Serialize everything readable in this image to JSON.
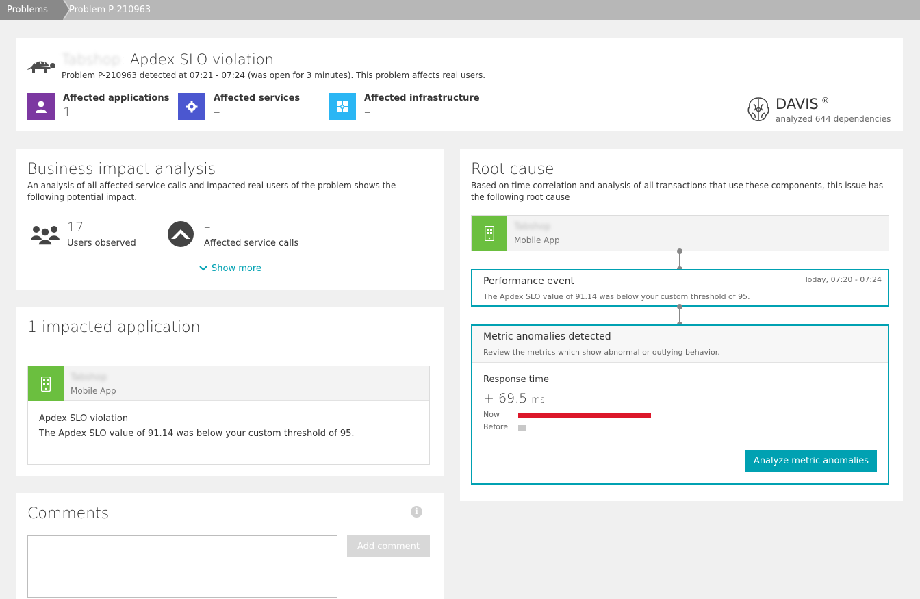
{
  "breadcrumb": {
    "items": [
      "Problems",
      "Problem P-210963"
    ]
  },
  "header": {
    "app_name": "Tabshop",
    "title_suffix": ": Apdex SLO violation",
    "subtitle": "Problem P-210963 detected at 07:21 - 07:24 (was open for 3 minutes). This problem affects real users.",
    "affected": [
      {
        "label": "Affected applications",
        "value": "1",
        "color": "#7c38a1"
      },
      {
        "label": "Affected services",
        "value": "–",
        "color": "#4b57d0"
      },
      {
        "label": "Affected infrastructure",
        "value": "–",
        "color": "#2ab6f4"
      }
    ],
    "davis": {
      "name": "DAVIS",
      "mark": "®",
      "subtitle": "analyzed 644 dependencies"
    }
  },
  "business_impact": {
    "title": "Business impact analysis",
    "description": "An analysis of all affected service calls and impacted real users of the problem shows the following potential impact.",
    "users_value": "17",
    "users_label": "Users observed",
    "calls_value": "–",
    "calls_label": "Affected service calls",
    "show_more": "Show more"
  },
  "impacted": {
    "title": "1 impacted application",
    "app_name": "Tabshop",
    "app_type": "Mobile App",
    "issue_title": "Apdex SLO violation",
    "issue_desc": "The Apdex SLO value of 91.14 was below your custom threshold of 95."
  },
  "comments": {
    "title": "Comments",
    "info_glyph": "i",
    "add_label": "Add comment"
  },
  "root_cause": {
    "title": "Root cause",
    "description": "Based on time correlation and analysis of all transactions that use these components, this issue has the following root cause",
    "app_name": "Tabshop",
    "app_type": "Mobile App",
    "performance_event": {
      "title": "Performance event",
      "time": "Today, 07:20 - 07:24",
      "desc": "The Apdex SLO value of 91.14 was below your custom threshold of 95."
    },
    "anomalies": {
      "title": "Metric anomalies detected",
      "desc": "Review the metrics which show abnormal or outlying behavior.",
      "metric_name": "Response time",
      "metric_value": "+ 69.5",
      "metric_unit": "ms",
      "now_label": "Now",
      "before_label": "Before",
      "now_fraction": 1.0,
      "before_fraction": 0.057,
      "now_color": "#dc172a",
      "before_color": "#c8c8c8",
      "button_label": "Analyze metric anomalies"
    }
  },
  "colors": {
    "accent": "#00a1b2",
    "mobile_app_green": "#6bbf3f"
  }
}
